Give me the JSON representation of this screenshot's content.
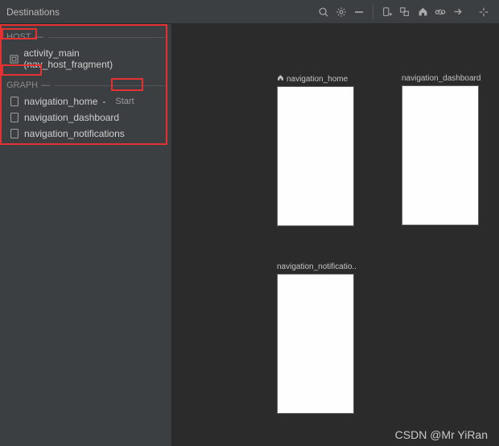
{
  "toolbar": {
    "title": "Destinations"
  },
  "sections": {
    "host": {
      "label": "HOST",
      "item": "activity_main (nav_host_fragment)"
    },
    "graph": {
      "label": "GRAPH",
      "items": [
        {
          "label": "navigation_home",
          "badge": "Start"
        },
        {
          "label": "navigation_dashboard",
          "badge": ""
        },
        {
          "label": "navigation_notifications",
          "badge": ""
        }
      ]
    }
  },
  "canvas": {
    "thumbs": [
      {
        "label": "navigation_home",
        "home_icon": true
      },
      {
        "label": "navigation_dashboard",
        "home_icon": false
      },
      {
        "label": "navigation_notificatio...",
        "home_icon": false
      }
    ]
  },
  "watermark": "CSDN @Mr YiRan"
}
